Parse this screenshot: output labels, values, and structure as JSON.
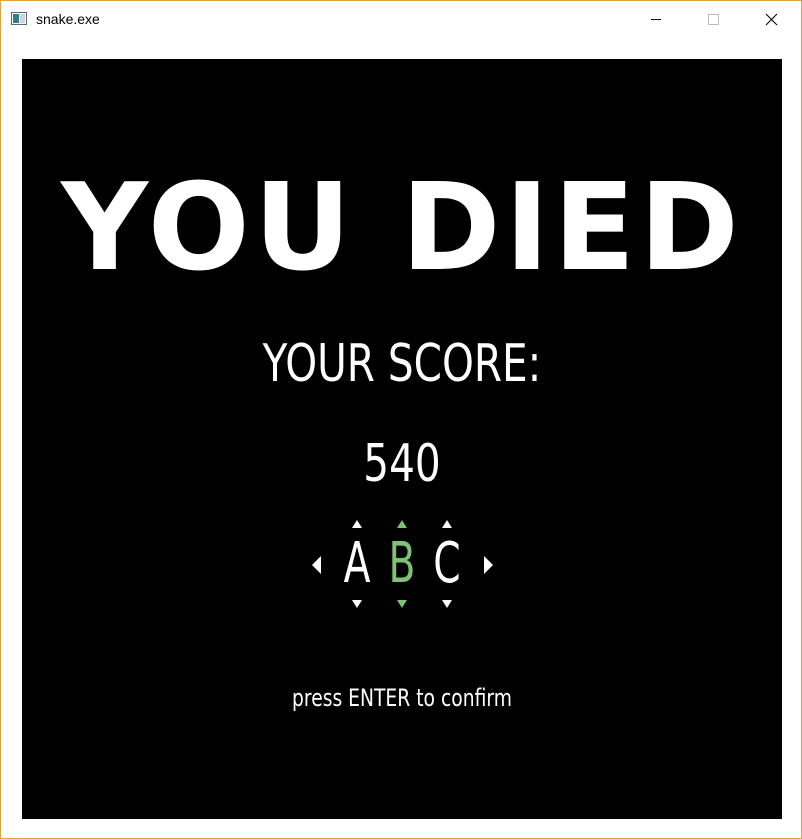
{
  "window": {
    "title": "snake.exe"
  },
  "icons": {
    "app": "app-window-icon",
    "minimize": "minimize-icon",
    "maximize": "maximize-icon",
    "close": "close-icon"
  },
  "game": {
    "headline": "YOU DIED",
    "score_label": "YOUR SCORE:",
    "score": "540",
    "initials": [
      "A",
      "B",
      "C"
    ],
    "selected_initial_index": 1,
    "confirm_hint": "press ENTER to confirm"
  },
  "colors": {
    "background": "#000000",
    "text": "#ffffff",
    "selected": "#7ec274",
    "window_border": "#e3a23c"
  }
}
